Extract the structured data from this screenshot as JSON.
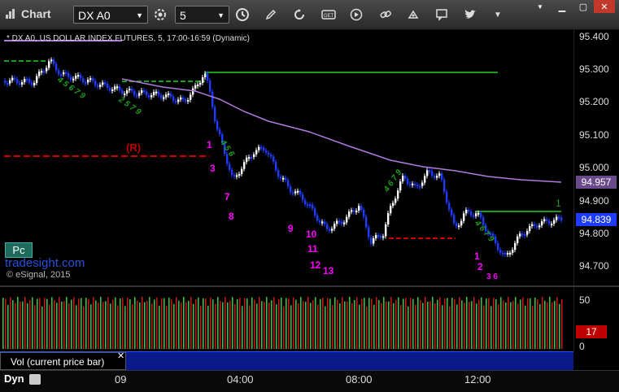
{
  "toolbar": {
    "title": "Chart",
    "symbol": "DX A0",
    "interval": "5",
    "icons": [
      "chart-icon",
      "symbol-dropdown-icon",
      "gear-icon",
      "interval-dropdown-icon",
      "clock-icon",
      "pencil-icon",
      "refresh-icon",
      "get-icon",
      "play-icon",
      "link-icon",
      "comment-icon",
      "twitter-icon",
      "dropdown-icon"
    ]
  },
  "chart": {
    "header": "* DX A0, US DOLLAR INDEX FUTURES, 5, 17:00-16:59 (Dynamic)",
    "watermark_site": "tradesight.com",
    "copyright": "© eSignal, 2015",
    "pc_badge": "Pc",
    "r_label": "(R)",
    "price_ticks": [
      "95.400",
      "95.300",
      "95.200",
      "95.100",
      "95.000",
      "94.900",
      "94.800",
      "94.700"
    ],
    "current_price": "94.839",
    "ma_price": "94.957",
    "count_label": "1",
    "sequence_labels": [
      "1",
      "3",
      "7",
      "8",
      "9",
      "10",
      "11",
      "12",
      "13",
      "1",
      "2"
    ],
    "colors": {
      "up": "#ffffff",
      "down": "#1e3cff",
      "ma": "#b07ae0",
      "red": "#e00000",
      "green": "#1a9e1a",
      "magenta": "#ff00ff"
    }
  },
  "volume": {
    "label": "Vol (current price bar)",
    "ticks": [
      "50",
      "0"
    ],
    "current": "17"
  },
  "timeaxis": {
    "mode": "Dyn",
    "labels": [
      "09",
      "04:00",
      "08:00",
      "12:00"
    ]
  }
}
